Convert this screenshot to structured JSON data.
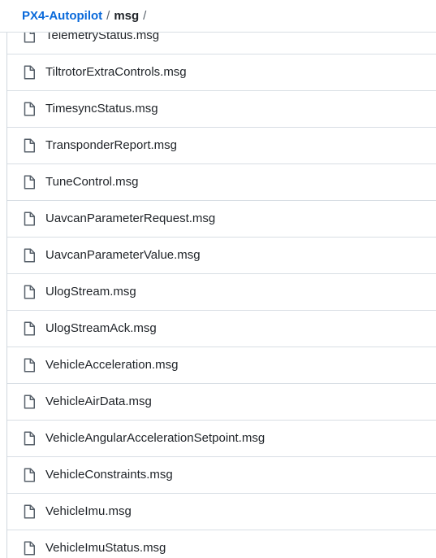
{
  "breadcrumb": {
    "repo": "PX4-Autopilot",
    "separator": "/",
    "directory": "msg",
    "trailing_separator": "/"
  },
  "file_icon": "file-icon",
  "files": [
    "TelemetryStatus.msg",
    "TiltrotorExtraControls.msg",
    "TimesyncStatus.msg",
    "TransponderReport.msg",
    "TuneControl.msg",
    "UavcanParameterRequest.msg",
    "UavcanParameterValue.msg",
    "UlogStream.msg",
    "UlogStreamAck.msg",
    "VehicleAcceleration.msg",
    "VehicleAirData.msg",
    "VehicleAngularAccelerationSetpoint.msg",
    "VehicleConstraints.msg",
    "VehicleImu.msg",
    "VehicleImuStatus.msg"
  ],
  "colors": {
    "link": "#0969da",
    "text": "#1f2328",
    "muted": "#57606a",
    "border": "#d8dee4"
  }
}
